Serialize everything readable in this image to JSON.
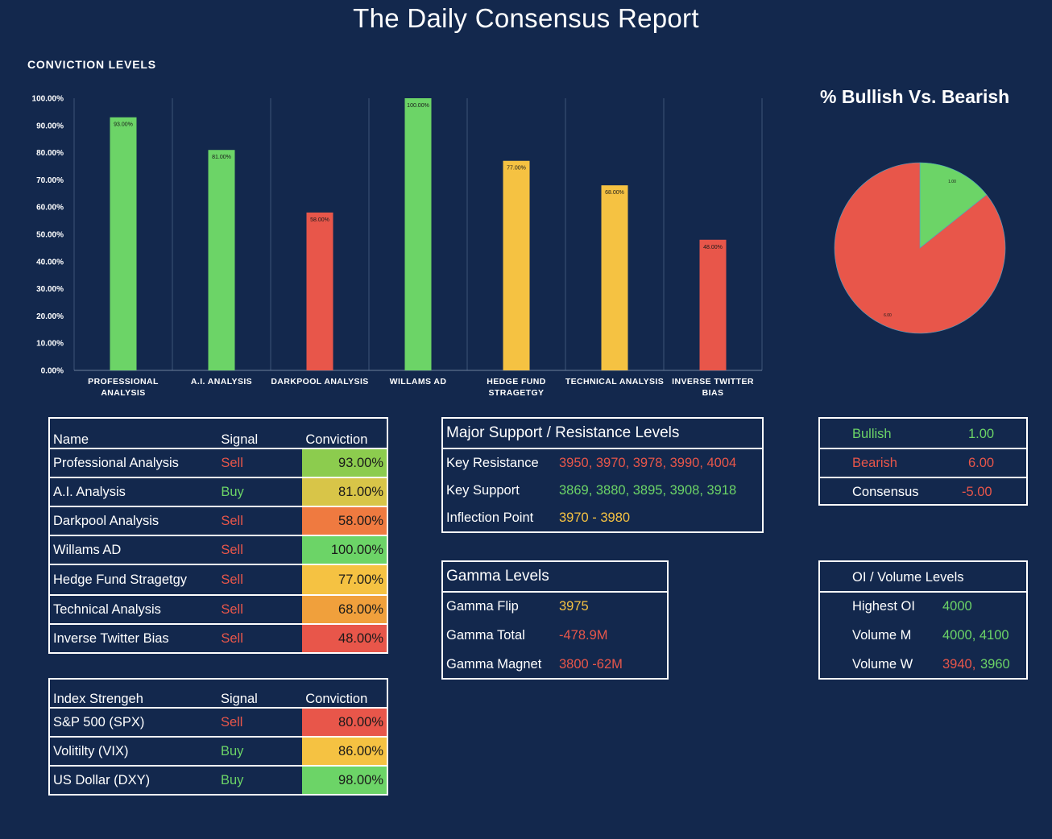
{
  "title": "The Daily Consensus Report",
  "colors": {
    "background": "#13284d",
    "green": "#6cd467",
    "red": "#e8564a",
    "yellow": "#f5c242"
  },
  "chart_data": [
    {
      "type": "bar",
      "title": "CONVICTION LEVELS",
      "categories": [
        [
          "PROFESSIONAL",
          "ANALYSIS"
        ],
        [
          "A.I. ANALYSIS"
        ],
        [
          "DARKPOOL ANALYSIS"
        ],
        [
          "WILLAMS AD"
        ],
        [
          "HEDGE FUND",
          "STRAGETGY"
        ],
        [
          "TECHNICAL ANALYSIS"
        ],
        [
          "INVERSE TWITTER",
          "BIAS"
        ]
      ],
      "values": [
        93,
        81,
        58,
        100,
        77,
        68,
        48
      ],
      "data_labels": [
        "93.00%",
        "81.00%",
        "58.00%",
        "100.00%",
        "77.00%",
        "68.00%",
        "48.00%"
      ],
      "bar_colors": [
        "#6cd467",
        "#6cd467",
        "#e8564a",
        "#6cd467",
        "#f5c242",
        "#f5c242",
        "#e8564a"
      ],
      "ylim": [
        0,
        100
      ],
      "yticks": [
        "0.00%",
        "10.00%",
        "20.00%",
        "30.00%",
        "40.00%",
        "50.00%",
        "60.00%",
        "70.00%",
        "80.00%",
        "90.00%",
        "100.00%"
      ],
      "grid": "vertical"
    },
    {
      "type": "pie",
      "title": "% Bullish Vs. Bearish",
      "values": [
        1.0,
        6.0
      ],
      "data_labels": [
        "1.00",
        "6.00"
      ],
      "colors": [
        "#6cd467",
        "#e8564a"
      ]
    }
  ],
  "signals_table": {
    "headers": [
      "Name",
      "Signal",
      "Conviction"
    ],
    "rows": [
      {
        "name": "Professional Analysis",
        "signal": "Sell",
        "conviction": "93.00%",
        "color": "#8ccc4e"
      },
      {
        "name": "A.I. Analysis",
        "signal": "Buy",
        "conviction": "81.00%",
        "color": "#d8c548"
      },
      {
        "name": "Darkpool Analysis",
        "signal": "Sell",
        "conviction": "58.00%",
        "color": "#ef7a40"
      },
      {
        "name": "Willams AD",
        "signal": "Sell",
        "conviction": "100.00%",
        "color": "#6cd467"
      },
      {
        "name": "Hedge Fund Stragetgy",
        "signal": "Sell",
        "conviction": "77.00%",
        "color": "#f5c242"
      },
      {
        "name": "Technical Analysis",
        "signal": "Sell",
        "conviction": "68.00%",
        "color": "#f0a03c"
      },
      {
        "name": "Inverse Twitter Bias",
        "signal": "Sell",
        "conviction": "48.00%",
        "color": "#e8564a"
      }
    ]
  },
  "index_table": {
    "headers": [
      "Index Strengeh",
      "Signal",
      "Conviction"
    ],
    "rows": [
      {
        "name": "S&P 500 (SPX)",
        "signal": "Sell",
        "conviction": "80.00%",
        "color": "#e8564a"
      },
      {
        "name": "Volitilty (VIX)",
        "signal": "Buy",
        "conviction": "86.00%",
        "color": "#f5c242"
      },
      {
        "name": "US Dollar (DXY)",
        "signal": "Buy",
        "conviction": "98.00%",
        "color": "#6cd467"
      }
    ]
  },
  "levels": {
    "title": "Major Support / Resistance Levels",
    "resistance_label": "Key Resistance",
    "resistance_value": "3950, 3970, 3978, 3990, 4004",
    "support_label": "Key Support",
    "support_value": "3869, 3880, 3895, 3908, 3918",
    "inflection_label": "Inflection Point",
    "inflection_value": "3970 - 3980"
  },
  "gamma": {
    "title": "Gamma Levels",
    "flip_label": "Gamma Flip",
    "flip_value": "3975",
    "total_label": "Gamma Total",
    "total_value": "-478.9M",
    "magnet_label": "Gamma Magnet",
    "magnet_value": "3800 -62M"
  },
  "summary": {
    "bullish_label": "Bullish",
    "bullish_value": "1.00",
    "bearish_label": "Bearish",
    "bearish_value": "6.00",
    "consensus_label": "Consensus",
    "consensus_value": "-5.00"
  },
  "oi": {
    "title": "OI / Volume Levels",
    "highest_label": "Highest OI",
    "highest_value": "4000",
    "vol_m_label": "Volume M",
    "vol_m_value": "4000, 4100",
    "vol_w_label": "Volume W",
    "vol_w_value_a": "3940,",
    "vol_w_value_b": "3960"
  }
}
